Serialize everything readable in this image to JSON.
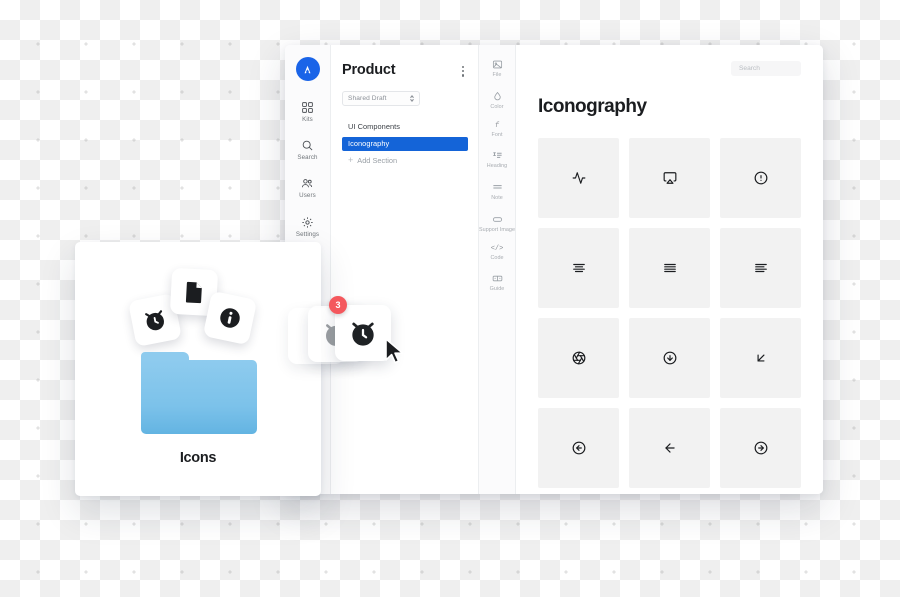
{
  "app": {
    "avatar_icon": "app-logo-a",
    "nav_items": [
      {
        "label": "Kits",
        "icon": "kits-icon"
      },
      {
        "label": "Search",
        "icon": "search-icon"
      },
      {
        "label": "Users",
        "icon": "users-icon"
      },
      {
        "label": "Settings",
        "icon": "gear-icon"
      }
    ]
  },
  "sections_panel": {
    "title": "Product",
    "menu_icon": "kebab-menu-icon",
    "draft_select": {
      "value": "Shared Draft",
      "icon": "stepper-chevrons-icon"
    },
    "items": [
      {
        "label": "UI Components",
        "active": false
      },
      {
        "label": "Iconography",
        "active": true
      }
    ],
    "add_section_label": "Add Section",
    "add_section_icon": "plus-icon"
  },
  "tools_rail": {
    "items": [
      {
        "label": "File",
        "icon": "file-image-icon"
      },
      {
        "label": "Color",
        "icon": "droplet-icon"
      },
      {
        "label": "Font",
        "icon": "font-f-icon"
      },
      {
        "label": "Heading",
        "icon": "heading-icon"
      },
      {
        "label": "Note",
        "icon": "note-lines-icon"
      },
      {
        "label": "Support Image",
        "icon": "support-image-icon"
      },
      {
        "label": "Code",
        "icon": "code-icon"
      },
      {
        "label": "Guide",
        "icon": "guide-icon"
      }
    ]
  },
  "content": {
    "title": "Iconography",
    "search": {
      "placeholder": "Search",
      "value": ""
    },
    "icons": [
      {
        "name": "activity-icon"
      },
      {
        "name": "airplay-icon"
      },
      {
        "name": "alert-circle-icon"
      },
      {
        "name": "align-center-icon"
      },
      {
        "name": "align-justify-icon"
      },
      {
        "name": "align-left-icon"
      },
      {
        "name": "aperture-icon"
      },
      {
        "name": "arrow-down-circle-icon"
      },
      {
        "name": "arrow-down-left-icon"
      },
      {
        "name": "arrow-left-circle-icon"
      },
      {
        "name": "arrow-left-icon"
      },
      {
        "name": "arrow-right-circle-icon"
      }
    ]
  },
  "finder_card": {
    "folder_label": "Icons",
    "folder_color": "#7cc2ea",
    "mini_icons": [
      {
        "name": "alarm-clock-icon"
      },
      {
        "name": "file-document-icon"
      },
      {
        "name": "info-circle-icon"
      }
    ]
  },
  "drag_stack": {
    "badge_count": "3",
    "badge_color": "#f4585d",
    "card_icon": "alarm-clock-icon",
    "cursor_icon": "mouse-pointer-icon"
  }
}
